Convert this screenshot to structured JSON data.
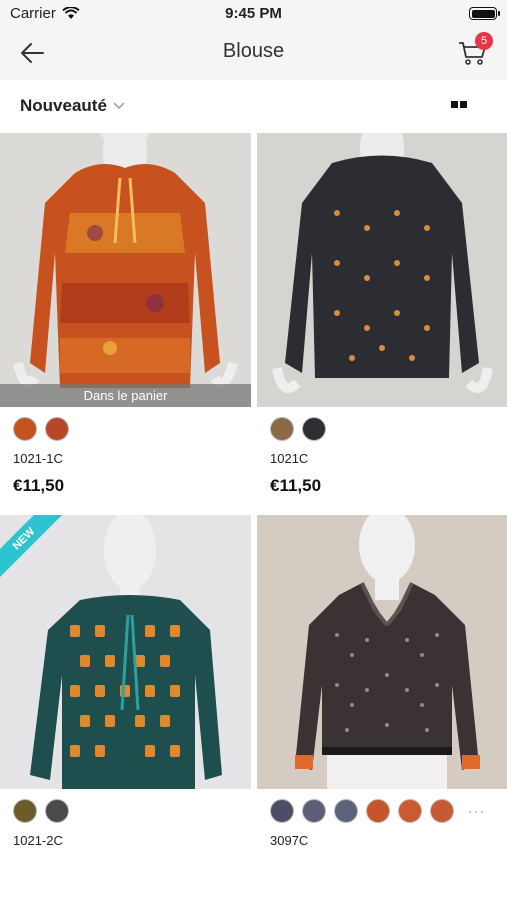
{
  "status_bar": {
    "carrier": "Carrier",
    "time": "9:45 PM"
  },
  "nav": {
    "title": "Blouse",
    "cart_count": "5"
  },
  "sort": {
    "label": "Nouveauté"
  },
  "products": [
    {
      "sku": "1021-1C",
      "price": "€11,50",
      "cart_label": "Dans le panier",
      "swatch_colors": [
        "#c4541f",
        "#b8472a"
      ]
    },
    {
      "sku": "1021C",
      "price": "€11,50",
      "swatch_colors": [
        "#8a6a45",
        "#2f2f33"
      ]
    },
    {
      "sku": "1021-2C",
      "price": "",
      "ribbon": "NEW",
      "swatch_colors": [
        "#6b5a2a",
        "#4a4a4a"
      ]
    },
    {
      "sku": "3097C",
      "price": "",
      "swatch_colors": [
        "#4a4f66",
        "#5a5f75",
        "#5b6478",
        "#c9542a",
        "#cc5a30",
        "#c75a35"
      ],
      "more_label": "···"
    }
  ]
}
